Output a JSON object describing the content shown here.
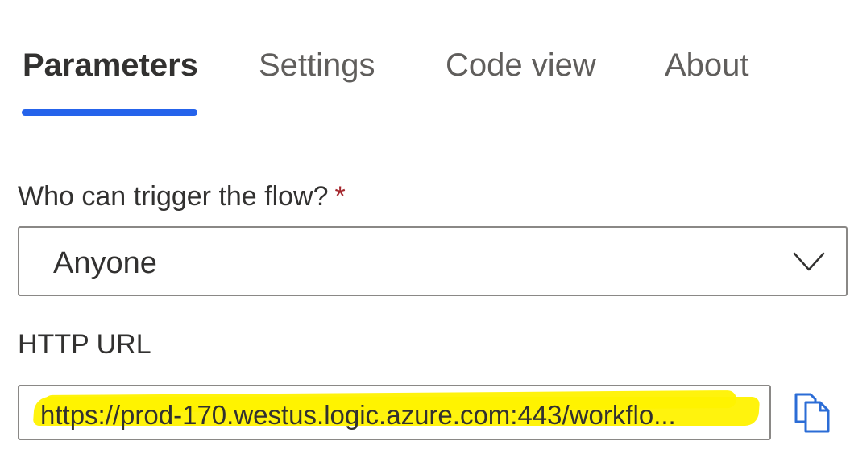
{
  "tabs": [
    {
      "label": "Parameters",
      "active": true
    },
    {
      "label": "Settings",
      "active": false
    },
    {
      "label": "Code view",
      "active": false
    },
    {
      "label": "About",
      "active": false
    }
  ],
  "trigger_field": {
    "label": "Who can trigger the flow?",
    "required_marker": "*",
    "value": "Anyone",
    "icon": "chevron-down-icon"
  },
  "url_field": {
    "label": "HTTP URL",
    "value": "https://prod-170.westus.logic.azure.com:443/workflo...",
    "copy_icon": "copy-icon"
  },
  "colors": {
    "accent": "#2563eb",
    "required": "#a4262c",
    "highlight": "#fff200",
    "icon": "#2b6cd6"
  }
}
